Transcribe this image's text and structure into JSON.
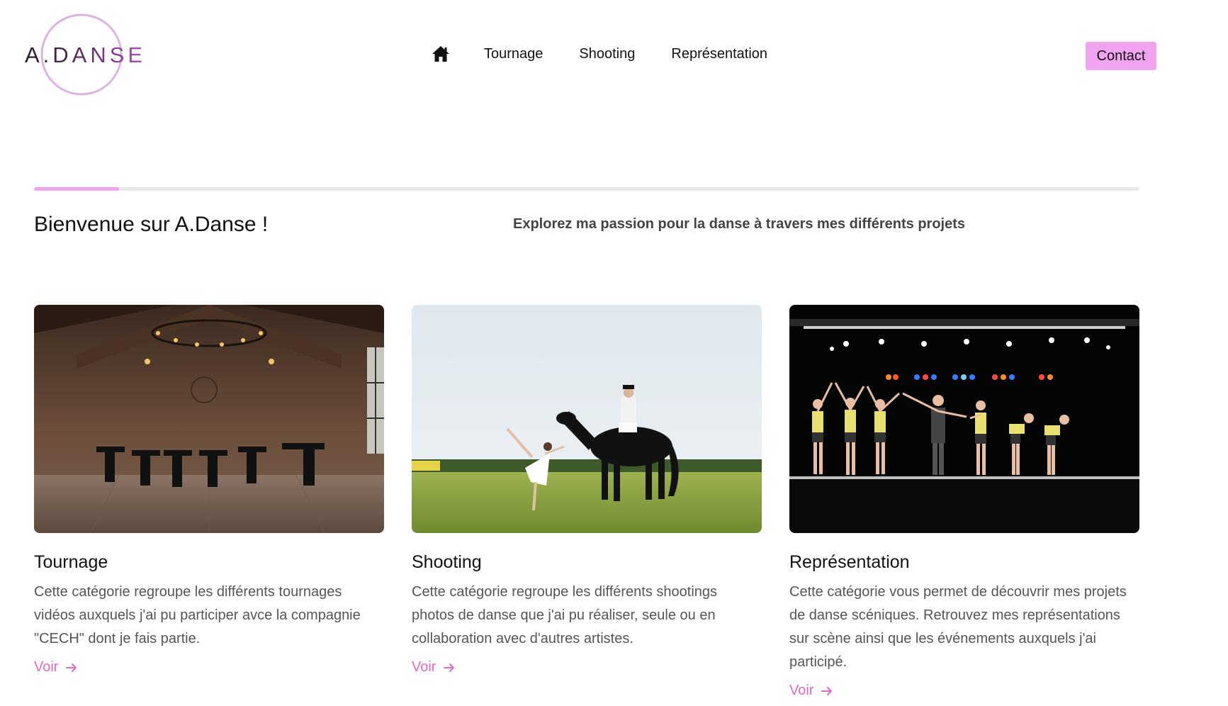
{
  "brand": {
    "logo_text": "A.DANSE",
    "accent_color": "#f0a4f0",
    "link_color": "#e36ac2"
  },
  "nav": {
    "home_icon": "home-icon",
    "items": [
      {
        "label": "Tournage"
      },
      {
        "label": "Shooting"
      },
      {
        "label": "Représentation"
      }
    ],
    "contact_label": "Contact"
  },
  "hero": {
    "progress": 0.077,
    "title": "Bienvenue sur A.Danse !",
    "subtitle": "Explorez ma passion pour la danse à travers mes différents projets"
  },
  "cards": [
    {
      "title": "Tournage",
      "description": "Cette catégorie regroupe les différents tournages vidéos auxquels j'ai pu participer avce la compagnie \"CECH\" dont je fais partie.",
      "link_label": "Voir"
    },
    {
      "title": "Shooting",
      "description": "Cette catégorie regroupe les différents shootings photos de danse que j'ai pu réaliser, seule ou en collaboration avec d'autres artistes.",
      "link_label": "Voir"
    },
    {
      "title": "Représentation",
      "description": "Cette catégorie vous permet de découvrir mes projets de danse scéniques. Retrouvez mes représentations sur scène ainsi que les événements auxquels j'ai participé.",
      "link_label": "Voir"
    }
  ]
}
